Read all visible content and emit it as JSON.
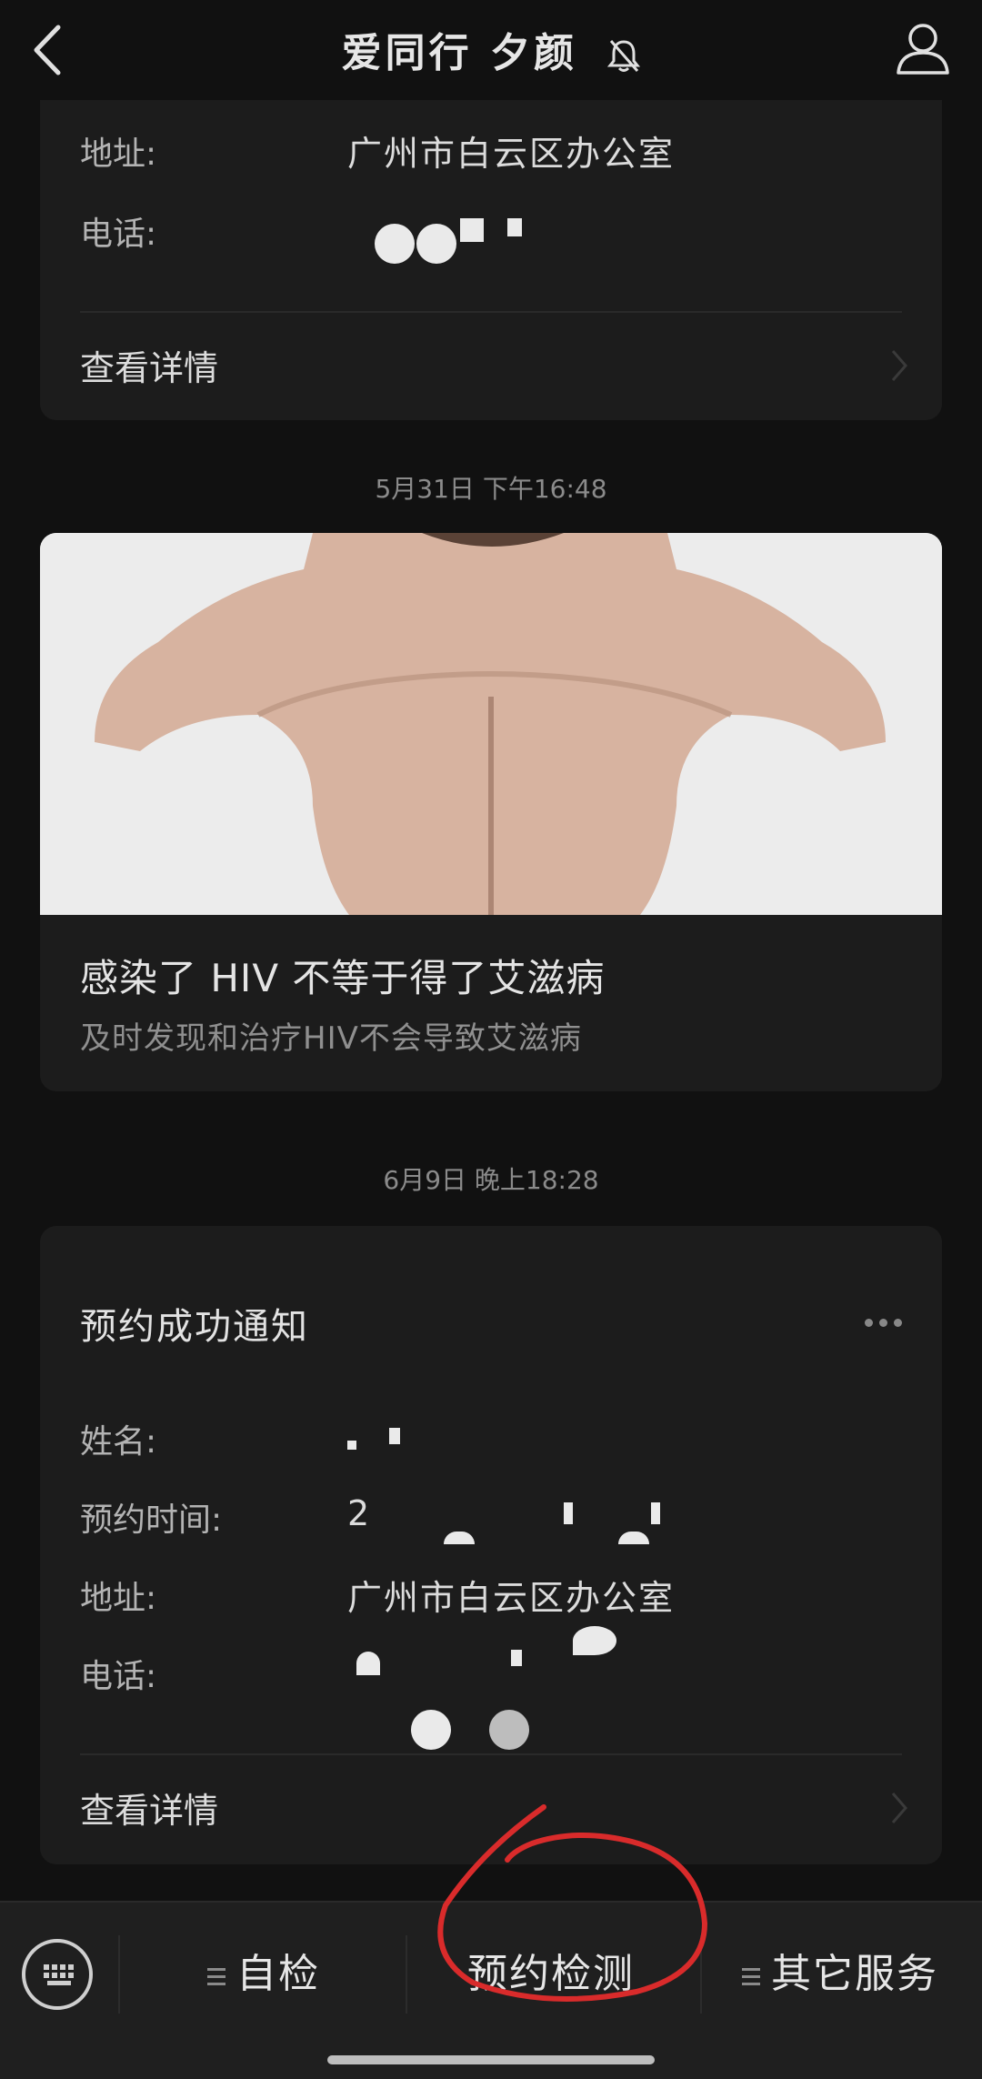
{
  "header": {
    "title": "爱同行 夕颜",
    "back_icon": "chevron-left-icon",
    "mute_icon": "bell-off-icon",
    "profile_icon": "user-icon"
  },
  "card1": {
    "address_label": "地址:",
    "address_value": "广州市白云区办公室",
    "phone_label": "电话:",
    "detail_label": "查看详情"
  },
  "timestamp1": "5月31日 下午16:48",
  "article": {
    "title": "感染了 HIV 不等于得了艾滋病",
    "subtitle": "及时发现和治疗HIV不会导致艾滋病"
  },
  "timestamp2": "6月9日 晚上18:28",
  "notice": {
    "title": "预约成功通知",
    "name_label": "姓名:",
    "time_label": "预约时间:",
    "time_value_partial": "2",
    "address_label": "地址:",
    "address_value": "广州市白云区办公室",
    "phone_label": "电话:",
    "detail_label": "查看详情"
  },
  "bottom_menu": {
    "keyboard_icon": "keyboard-icon",
    "tab1": "自检",
    "tab2": "预约检测",
    "tab3": "其它服务"
  },
  "colors": {
    "background": "#111111",
    "card": "#1c1c1c",
    "annotation": "#d92b2b"
  }
}
